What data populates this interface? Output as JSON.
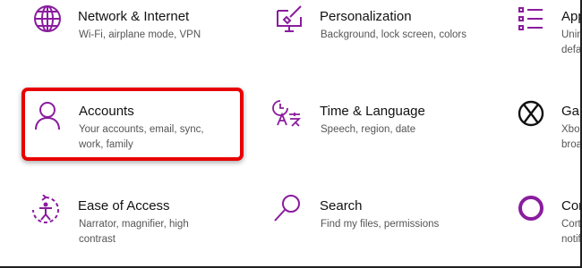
{
  "accent_color": "#8a1c9e",
  "highlight_color": "#e80000",
  "tiles": [
    {
      "name": "network",
      "icon": "globe-icon",
      "title": "Network & Internet",
      "desc": "Wi-Fi, airplane mode, VPN"
    },
    {
      "name": "personalization",
      "icon": "monitor-brush-icon",
      "title": "Personalization",
      "desc": "Background, lock screen, colors"
    },
    {
      "name": "apps",
      "icon": "apps-list-icon",
      "title": "App",
      "desc": "Unin"
    },
    {
      "name": "accounts",
      "icon": "person-icon",
      "title": "Accounts",
      "desc": "Your accounts, email, sync, work, family"
    },
    {
      "name": "time-language",
      "icon": "time-language-icon",
      "title": "Time & Language",
      "desc": "Speech, region, date"
    },
    {
      "name": "gaming",
      "icon": "xbox-icon",
      "title": "Gam",
      "desc": "Xbo"
    },
    {
      "name": "ease-of-access",
      "icon": "ease-of-access-icon",
      "title": "Ease of Access",
      "desc": "Narrator, magnifier, high contrast"
    },
    {
      "name": "search",
      "icon": "magnifier-icon",
      "title": "Search",
      "desc": "Find my files, permissions"
    },
    {
      "name": "cortana",
      "icon": "cortana-icon",
      "title": "Cor",
      "desc": "Cort"
    }
  ],
  "apps_desc_line2": "defa",
  "gaming_desc_line2": "broa",
  "cortana_desc_line2": "notif"
}
